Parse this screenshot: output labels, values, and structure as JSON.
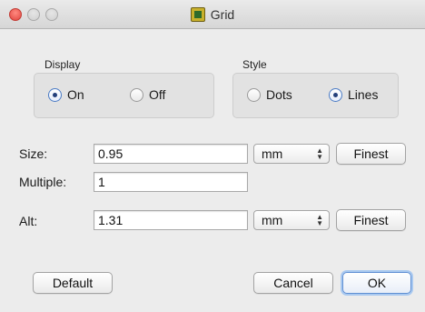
{
  "window": {
    "title": "Grid"
  },
  "display": {
    "label": "Display",
    "options": [
      {
        "label": "On",
        "selected": true
      },
      {
        "label": "Off",
        "selected": false
      }
    ]
  },
  "style": {
    "label": "Style",
    "options": [
      {
        "label": "Dots",
        "selected": false
      },
      {
        "label": "Lines",
        "selected": true
      }
    ]
  },
  "size": {
    "label": "Size:",
    "value": "0.95",
    "unit": "mm",
    "button": "Finest"
  },
  "multiple": {
    "label": "Multiple:",
    "value": "1"
  },
  "alt": {
    "label": "Alt:",
    "value": "1.31",
    "unit": "mm",
    "button": "Finest"
  },
  "buttons": {
    "default": "Default",
    "cancel": "Cancel",
    "ok": "OK"
  },
  "colors": {
    "accent": "#4b7bc4",
    "close": "#e0443e"
  }
}
